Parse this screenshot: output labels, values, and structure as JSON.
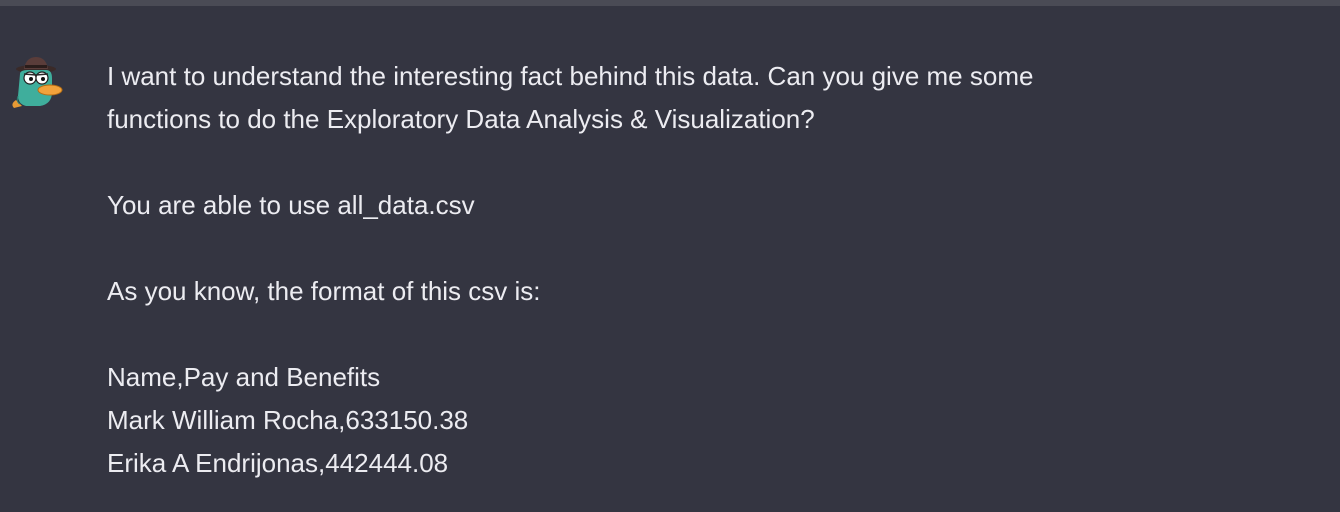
{
  "message": {
    "role": "user",
    "avatar_icon": "perry-the-platypus-avatar-icon",
    "lines": [
      "I want to understand the interesting fact behind this data. Can you give me some",
      "functions to do the Exploratory Data Analysis & Visualization?",
      "",
      "You are able to use all_data.csv",
      "",
      "As you know, the format of this csv is:",
      "",
      "Name,Pay and Benefits",
      "Mark William Rocha,633150.38",
      "Erika A Endrijonas,442444.08"
    ]
  },
  "colors": {
    "background": "#343541",
    "text": "#ececf1",
    "top_border": "#4a4b55"
  }
}
